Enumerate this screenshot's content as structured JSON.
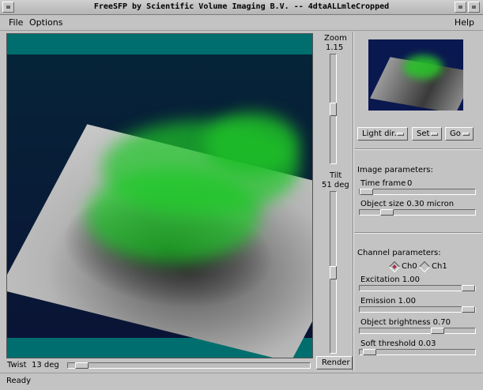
{
  "window": {
    "title": "FreeSFP by Scientific Volume Imaging B.V. -- 4dtaALLmleCropped"
  },
  "menu": {
    "file": "File",
    "options": "Options",
    "help": "Help"
  },
  "zoom": {
    "label": "Zoom",
    "value": "1.15",
    "level": 0.5
  },
  "tilt": {
    "label": "Tilt",
    "value": "51 deg",
    "level": 0.5
  },
  "twist": {
    "label": "Twist",
    "value": "13 deg",
    "level": 0.03
  },
  "render_button": "Render",
  "view_buttons": {
    "light_dir": "Light dir.",
    "set": "Set",
    "go": "Go"
  },
  "image_params": {
    "heading": "Image parameters:",
    "time_frame": {
      "label": "Time frame",
      "value": "0",
      "level": 0.0
    },
    "object_size": {
      "label": "Object size 0.30 micron",
      "level": 0.2
    }
  },
  "channel_params": {
    "heading": "Channel parameters:",
    "channels": [
      "Ch0",
      "Ch1"
    ],
    "selected_channel": "Ch0",
    "excitation": {
      "label": "Excitation 1.00",
      "level": 1.0
    },
    "emission": {
      "label": "Emission 1.00",
      "level": 1.0
    },
    "object_brightness": {
      "label": "Object brightness 0.70",
      "level": 0.7
    },
    "soft_threshold": {
      "label": "Soft threshold 0.03",
      "level": 0.03
    }
  },
  "status": "Ready",
  "colors": {
    "background": "#c3c3c3",
    "viewport_band": "#006e6e",
    "viewport_bg": "#0a1436",
    "signal_green": "#1ec828"
  }
}
